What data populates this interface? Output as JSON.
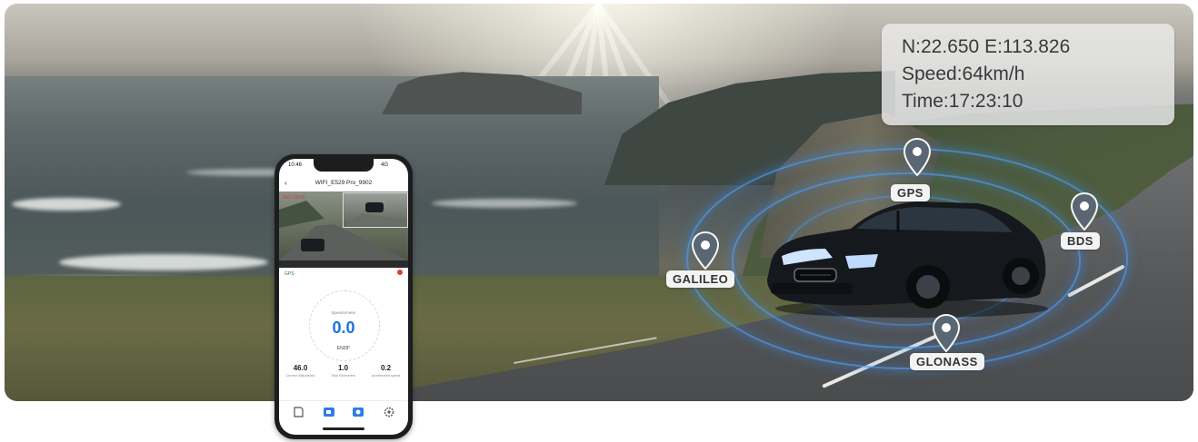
{
  "gps_overlay": {
    "coords": "N:22.650  E:113.826",
    "speed": "Speed:64km/h",
    "time": "Time:17:23:10"
  },
  "satellites": [
    {
      "label": "GPS",
      "icon": "location-pin-icon"
    },
    {
      "label": "BDS",
      "icon": "location-pin-icon"
    },
    {
      "label": "GALILEO",
      "icon": "location-pin-icon"
    },
    {
      "label": "GLONASS",
      "icon": "location-pin-icon"
    }
  ],
  "colors": {
    "ring": "#5096e6",
    "pin": "#5a6672",
    "accent": "#1e6fe0"
  },
  "phone": {
    "time": "10:46",
    "signal": "4G",
    "title": "WIFI_E529 Pro_9902",
    "rec": "REC 00:00",
    "gps_status": "GPS",
    "speed_label": "Speedometer",
    "speed_value": "0.0",
    "direction": "EN28°",
    "stats": [
      {
        "value": "46.0",
        "label": "Current Altitude(m)"
      },
      {
        "value": "1.0",
        "label": "Total Kilometers"
      },
      {
        "value": "0.2",
        "label": "Accelerated speed"
      }
    ],
    "tabs": [
      "sd-card-icon",
      "camera-icon",
      "photo-icon",
      "settings-icon"
    ]
  }
}
